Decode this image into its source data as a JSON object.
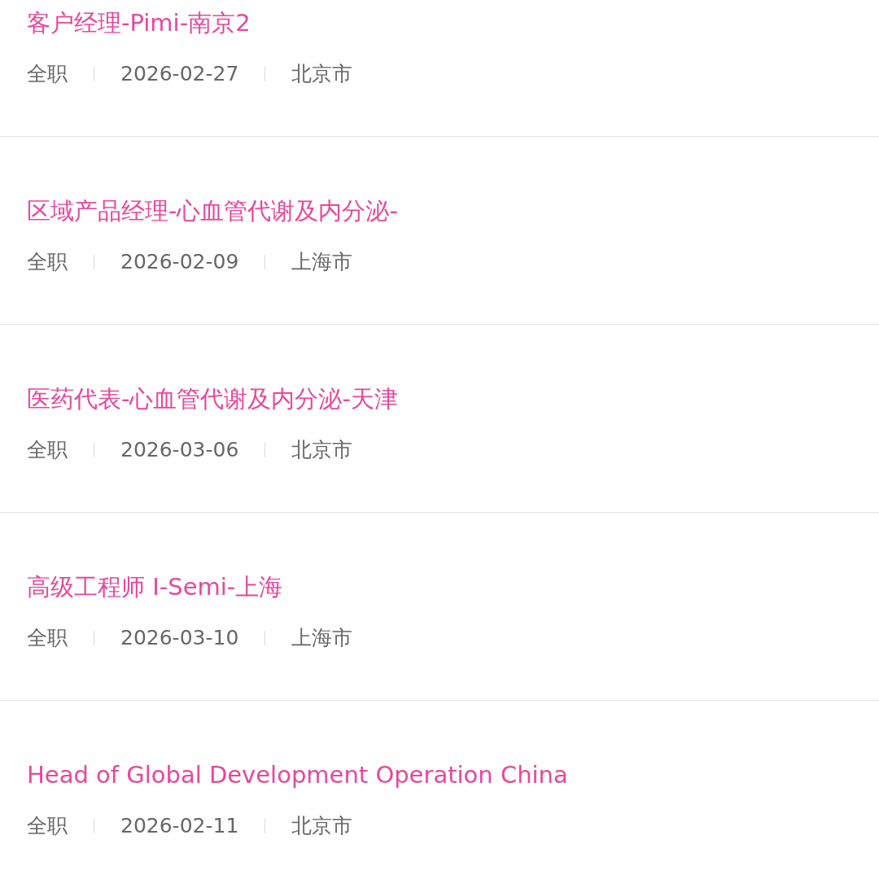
{
  "jobs": [
    {
      "title": "客户经理-Pimi-南京2",
      "type": "全职",
      "date": "2026-02-27",
      "city": "北京市"
    },
    {
      "title": "区域产品经理-心血管代谢及内分泌-",
      "type": "全职",
      "date": "2026-02-09",
      "city": "上海市"
    },
    {
      "title": "医药代表-心血管代谢及内分泌-天津",
      "type": "全职",
      "date": "2026-03-06",
      "city": "北京市"
    },
    {
      "title": "高级工程师 I-Semi-上海",
      "type": "全职",
      "date": "2026-03-10",
      "city": "上海市"
    },
    {
      "title": "Head of Global Development Operation China",
      "type": "全职",
      "date": "2026-02-11",
      "city": "北京市"
    }
  ]
}
